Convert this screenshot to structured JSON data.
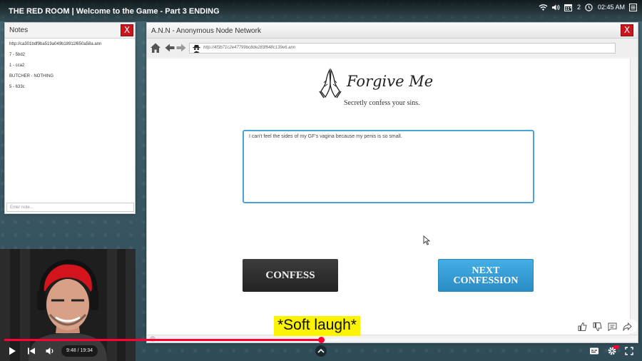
{
  "video": {
    "title": "THE RED ROOM | Welcome to the Game - Part 3 ENDING",
    "subtitle": "*Soft laugh*",
    "time_current": "9:48",
    "time_total": "19:34",
    "progress_fraction": 0.501,
    "buffer_fraction": 0.53
  },
  "status": {
    "workspace_number": "2",
    "clock": "02:45 AM"
  },
  "notes_window": {
    "title": "Notes",
    "close_label": "X",
    "items": [
      "http://ca301bdf9ba519a049b18911f650a58a.ann",
      "7 - 5bd2",
      "1 - cca2",
      "BUTCHER - NOTHING",
      "5 - 633c"
    ],
    "input_placeholder": "Enter note..."
  },
  "browser": {
    "title": "A.N.N - Anonymous Node Network",
    "close_label": "X",
    "url": "http://4f3b71c2e47799bc8de283f648c139e6.ann"
  },
  "page": {
    "site_title": "Forgive Me",
    "tagline": "Secretly confess your sins.",
    "confession_text": "I can't feel the sides of my GF's vagina because my penis is so small.",
    "confess_button": "CONFESS",
    "next_button_line1": "NEXT",
    "next_button_line2": "CONFESSION"
  },
  "colors": {
    "close_red": "#c8161d",
    "accent_blue": "#3a9bd6",
    "confess_dark": "#2d2d2d",
    "progress_red": "#ff0033",
    "subtitle_yellow": "#fcf300"
  }
}
